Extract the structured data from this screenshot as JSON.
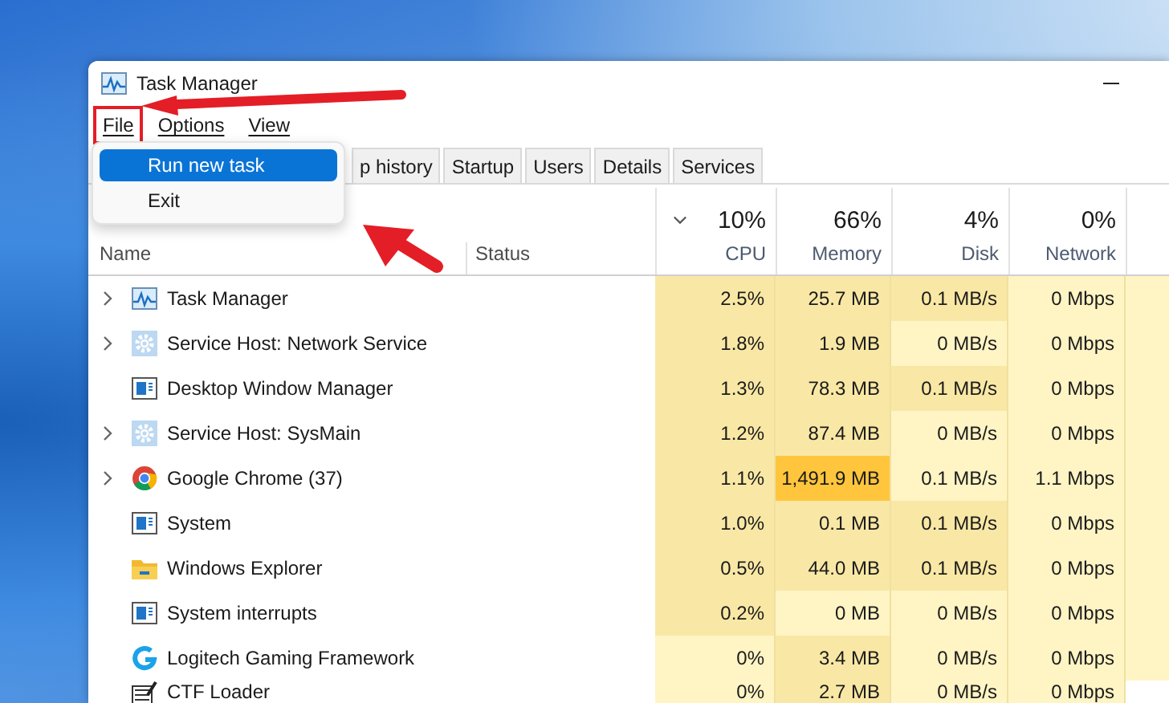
{
  "window": {
    "title": "Task Manager"
  },
  "menu": [
    {
      "label": "File",
      "highlighted": true
    },
    {
      "label": "Options",
      "highlighted": false
    },
    {
      "label": "View",
      "highlighted": false
    }
  ],
  "file_menu": [
    {
      "label": "Run new task",
      "selected": true
    },
    {
      "label": "Exit",
      "selected": false
    }
  ],
  "tabs": [
    "p history",
    "Startup",
    "Users",
    "Details",
    "Services"
  ],
  "table": {
    "name_header": "Name",
    "status_header": "Status",
    "columns": [
      {
        "percent": "10%",
        "label": "CPU",
        "sorted": true
      },
      {
        "percent": "66%",
        "label": "Memory",
        "sorted": false
      },
      {
        "percent": "4%",
        "label": "Disk",
        "sorted": false
      },
      {
        "percent": "0%",
        "label": "Network",
        "sorted": false
      }
    ],
    "rows": [
      {
        "name": "Task Manager",
        "kind": "chart",
        "expandable": true,
        "cells": [
          {
            "text": "2.5%",
            "kind": "medium"
          },
          {
            "text": "25.7 MB",
            "kind": "medium"
          },
          {
            "text": "0.1 MB/s",
            "kind": "medium"
          },
          {
            "text": "0 Mbps",
            "kind": "light"
          }
        ]
      },
      {
        "name": "Service Host: Network Service",
        "kind": "gear",
        "expandable": true,
        "cells": [
          {
            "text": "1.8%",
            "kind": "medium"
          },
          {
            "text": "1.9 MB",
            "kind": "medium"
          },
          {
            "text": "0 MB/s",
            "kind": "light"
          },
          {
            "text": "0 Mbps",
            "kind": "light"
          }
        ]
      },
      {
        "name": "Desktop Window Manager",
        "kind": "window",
        "expandable": false,
        "cells": [
          {
            "text": "1.3%",
            "kind": "medium"
          },
          {
            "text": "78.3 MB",
            "kind": "medium"
          },
          {
            "text": "0.1 MB/s",
            "kind": "medium"
          },
          {
            "text": "0 Mbps",
            "kind": "light"
          }
        ]
      },
      {
        "name": "Service Host: SysMain",
        "kind": "gear",
        "expandable": true,
        "cells": [
          {
            "text": "1.2%",
            "kind": "medium"
          },
          {
            "text": "87.4 MB",
            "kind": "medium"
          },
          {
            "text": "0 MB/s",
            "kind": "light"
          },
          {
            "text": "0 Mbps",
            "kind": "light"
          }
        ]
      },
      {
        "name": "Google Chrome (37)",
        "kind": "chrome",
        "expandable": true,
        "cells": [
          {
            "text": "1.1%",
            "kind": "medium"
          },
          {
            "text": "1,491.9 MB",
            "kind": "strong"
          },
          {
            "text": "0.1 MB/s",
            "kind": "light"
          },
          {
            "text": "1.1 Mbps",
            "kind": "light"
          }
        ]
      },
      {
        "name": "System",
        "kind": "window",
        "expandable": false,
        "cells": [
          {
            "text": "1.0%",
            "kind": "medium"
          },
          {
            "text": "0.1 MB",
            "kind": "medium"
          },
          {
            "text": "0.1 MB/s",
            "kind": "medium"
          },
          {
            "text": "0 Mbps",
            "kind": "light"
          }
        ]
      },
      {
        "name": "Windows Explorer",
        "kind": "folder",
        "expandable": false,
        "cells": [
          {
            "text": "0.5%",
            "kind": "medium"
          },
          {
            "text": "44.0 MB",
            "kind": "medium"
          },
          {
            "text": "0.1 MB/s",
            "kind": "medium"
          },
          {
            "text": "0 Mbps",
            "kind": "light"
          }
        ]
      },
      {
        "name": "System interrupts",
        "kind": "window",
        "expandable": false,
        "cells": [
          {
            "text": "0.2%",
            "kind": "medium"
          },
          {
            "text": "0 MB",
            "kind": "light"
          },
          {
            "text": "0 MB/s",
            "kind": "light"
          },
          {
            "text": "0 Mbps",
            "kind": "light"
          }
        ]
      },
      {
        "name": "Logitech Gaming Framework",
        "kind": "logo-g",
        "expandable": false,
        "cells": [
          {
            "text": "0%",
            "kind": "light"
          },
          {
            "text": "3.4 MB",
            "kind": "medium"
          },
          {
            "text": "0 MB/s",
            "kind": "light"
          },
          {
            "text": "0 Mbps",
            "kind": "light"
          }
        ]
      },
      {
        "name": "CTF Loader",
        "kind": "pen",
        "expandable": false,
        "cells": [
          {
            "text": "0%",
            "kind": "light"
          },
          {
            "text": "2.7 MB",
            "kind": "medium"
          },
          {
            "text": "0 MB/s",
            "kind": "light"
          },
          {
            "text": "0 Mbps",
            "kind": "light"
          }
        ]
      }
    ]
  }
}
